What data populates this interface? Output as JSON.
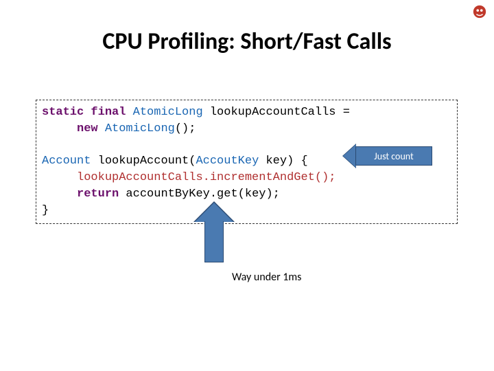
{
  "title": "CPU Profiling: Short/Fast Calls",
  "code": {
    "l1": {
      "kw1": "static final",
      "type1": "AtomicLong",
      "name1": " lookupAccountCalls ="
    },
    "l2": {
      "kw1": "new",
      "type1": "AtomicLong",
      "tail": "();"
    },
    "l3": {
      "type1": "Account",
      "name1": " lookupAccount(",
      "type2": "AccoutKey",
      "tail": " key) {"
    },
    "l4": {
      "em": "lookupAccountCalls.incrementAndGet();"
    },
    "l5": {
      "kw1": "return",
      "tail": " accountByKey.get(key);"
    },
    "l6": {
      "tail": "}"
    }
  },
  "callout_right": "Just count",
  "callout_up": "Way under 1ms"
}
